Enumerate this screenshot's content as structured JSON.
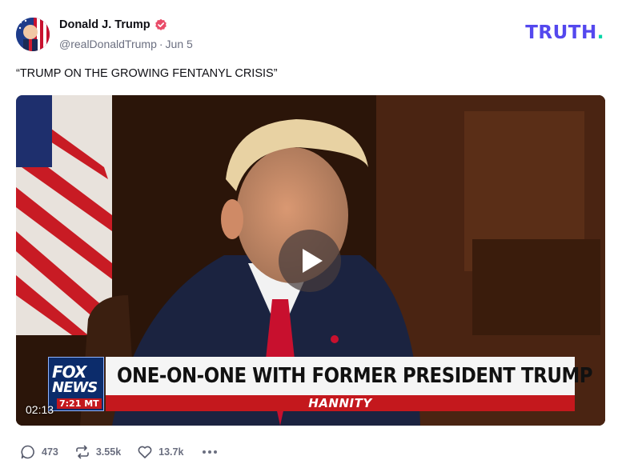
{
  "post": {
    "author": {
      "display_name": "Donald J. Trump",
      "handle": "@realDonaldTrump",
      "date": "Jun 5",
      "verified": true
    },
    "brand": {
      "wordmark": "TRUTH",
      "dot": ".",
      "color": "#5448ee",
      "dot_color": "#00d5a7"
    },
    "text": "“TRUMP ON THE GROWING FENTANYL CRISIS”",
    "video": {
      "duration": "02:13",
      "lower_third": {
        "network": "FOX",
        "network_sub": "NEWS",
        "time": "7:21 MT",
        "headline": "ONE-ON-ONE WITH FORMER PRESIDENT TRUMP",
        "show": "HANNITY"
      }
    },
    "actions": {
      "replies": "473",
      "retruths": "3.55k",
      "likes": "13.7k"
    }
  },
  "icons": {
    "verified": "verified-badge-icon",
    "reply": "reply-bubble-icon",
    "retruth": "retruth-arrows-icon",
    "like": "heart-icon",
    "more": "more-dots-icon",
    "play": "play-icon"
  },
  "colors": {
    "verified": "#e94b68",
    "muted": "#6b6f80",
    "fox_red": "#c4181d",
    "fox_blue": "#0c2c6b"
  }
}
